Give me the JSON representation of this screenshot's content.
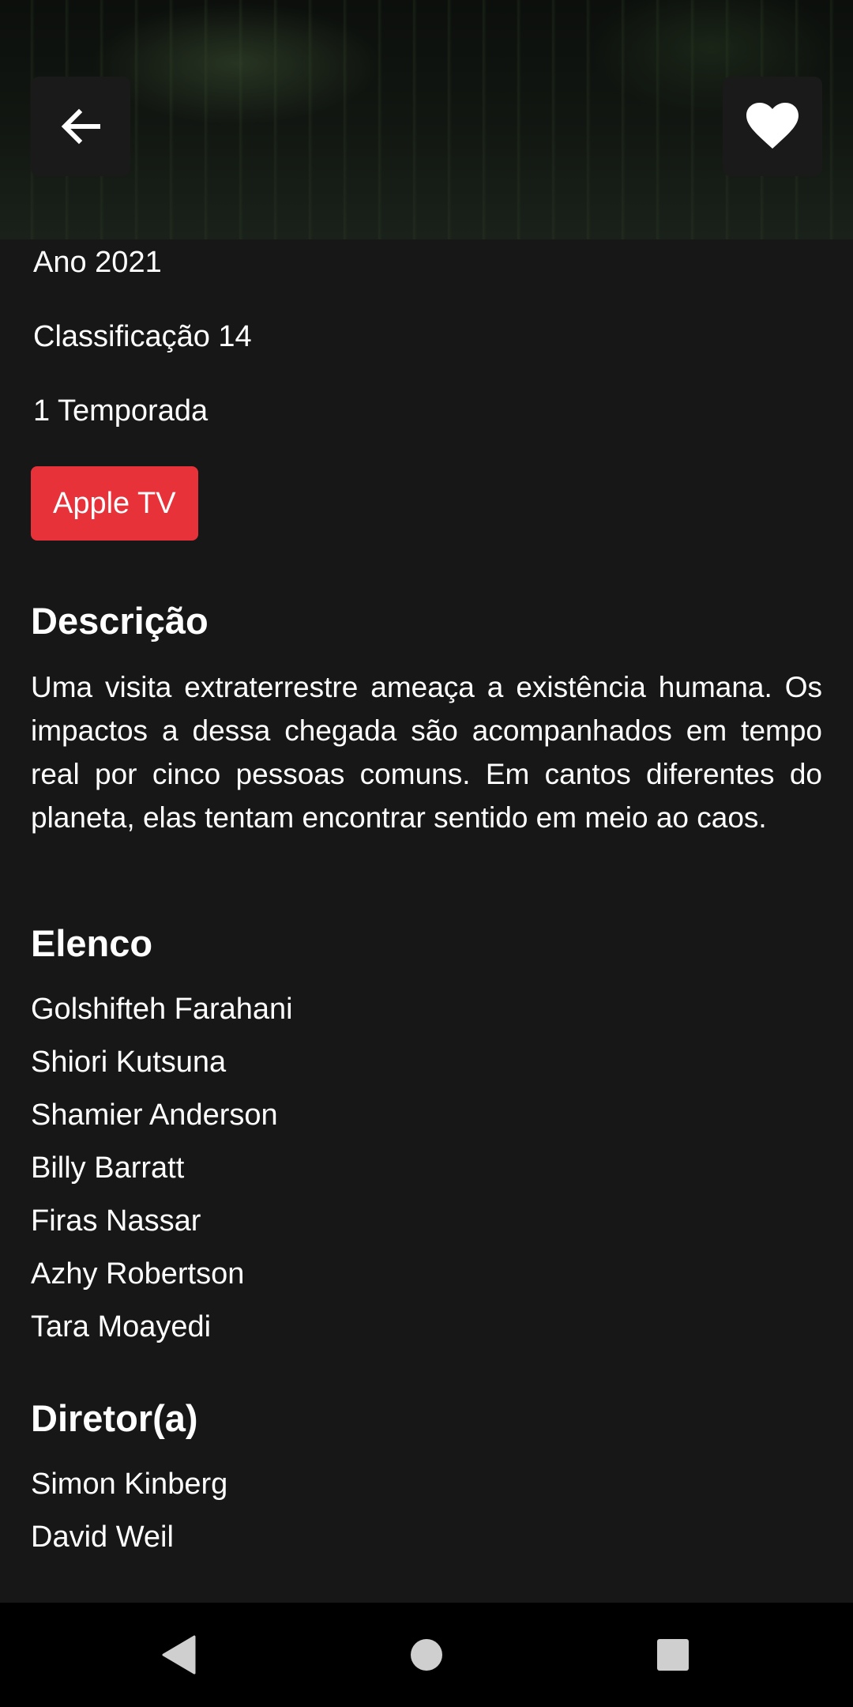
{
  "header": {
    "back_icon": "arrow-left-icon",
    "favorite_icon": "heart-icon"
  },
  "details": {
    "year": "Ano 2021",
    "rating": "Classificação 14",
    "seasons": "1 Temporada",
    "provider": "Apple TV",
    "provider_color": "#e8323a"
  },
  "description": {
    "title": "Descrição",
    "text": "Uma visita extraterrestre ameaça a existência humana. Os impactos a dessa chegada são acompanhados em tempo real por cinco pessoas comuns. Em cantos diferentes do planeta, elas tentam encontrar sentido em meio ao caos."
  },
  "cast": {
    "title": "Elenco",
    "names": [
      "Golshifteh Farahani",
      "Shiori Kutsuna",
      "Shamier Anderson",
      "Billy Barratt",
      "Firas Nassar",
      "Azhy Robertson",
      "Tara Moayedi"
    ]
  },
  "directors": {
    "title": "Diretor(a)",
    "names": [
      "Simon Kinberg",
      "David Weil"
    ]
  },
  "navbar": {
    "back_icon": "triangle-back-icon",
    "home_icon": "circle-home-icon",
    "recents_icon": "square-recents-icon"
  }
}
